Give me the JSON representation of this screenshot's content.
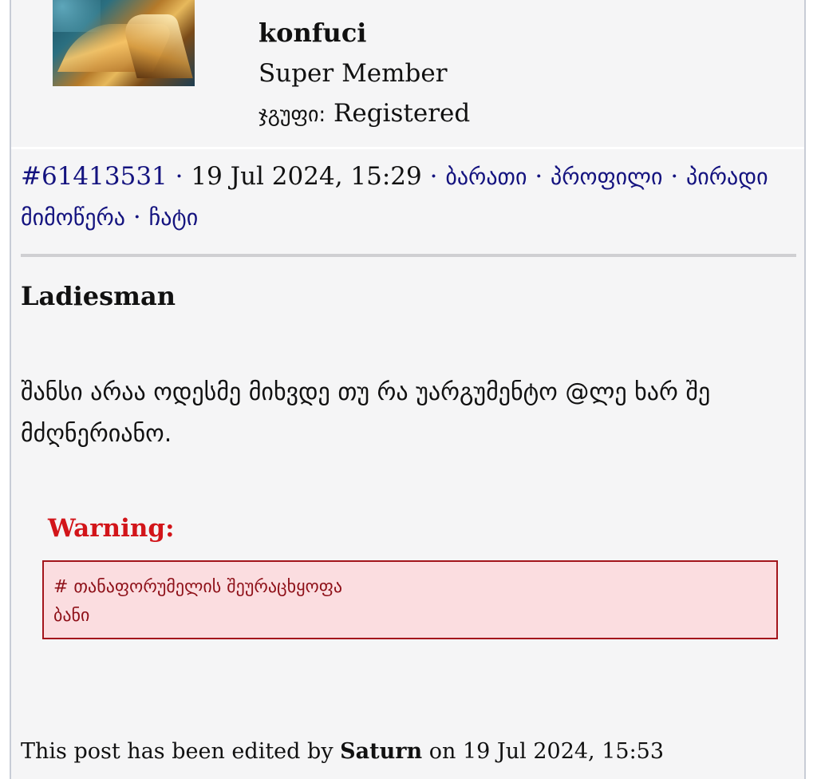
{
  "profile": {
    "username": "konfuci",
    "rank": "Super Member",
    "group_label": "ჯგუფი:",
    "group_value": "Registered",
    "avatar_icon": "book-pages-avatar"
  },
  "post_meta": {
    "post_number": "#61413531",
    "separator": "·",
    "datetime": "19 Jul 2024, 15:29",
    "links": {
      "card": "ბარათი",
      "profile": "პროფილი",
      "private_message": "პირადი მიმოწერა",
      "chat": "ჩატი"
    }
  },
  "quote": {
    "author": "Ladiesman"
  },
  "post_body": {
    "text": "შანსი არაა ოდესმე მიხვდე თუ რა უარგუმენტო @ლე ხარ შე მძღნერიანო."
  },
  "warning": {
    "label": "Warning:",
    "line1": "# თანაფორუმელის შეურაცხყოფა",
    "line2": "ბანი"
  },
  "edit_note": {
    "prefix": "This post has been edited by",
    "editor": "Saturn",
    "middle": "on",
    "datetime": "19 Jul 2024, 15:53"
  },
  "colors": {
    "link": "#14137f",
    "warning_text": "#d2151a",
    "warning_box_bg": "#fbdde0",
    "warning_box_border": "#a3151c",
    "panel_bg": "#f5f5f6"
  }
}
